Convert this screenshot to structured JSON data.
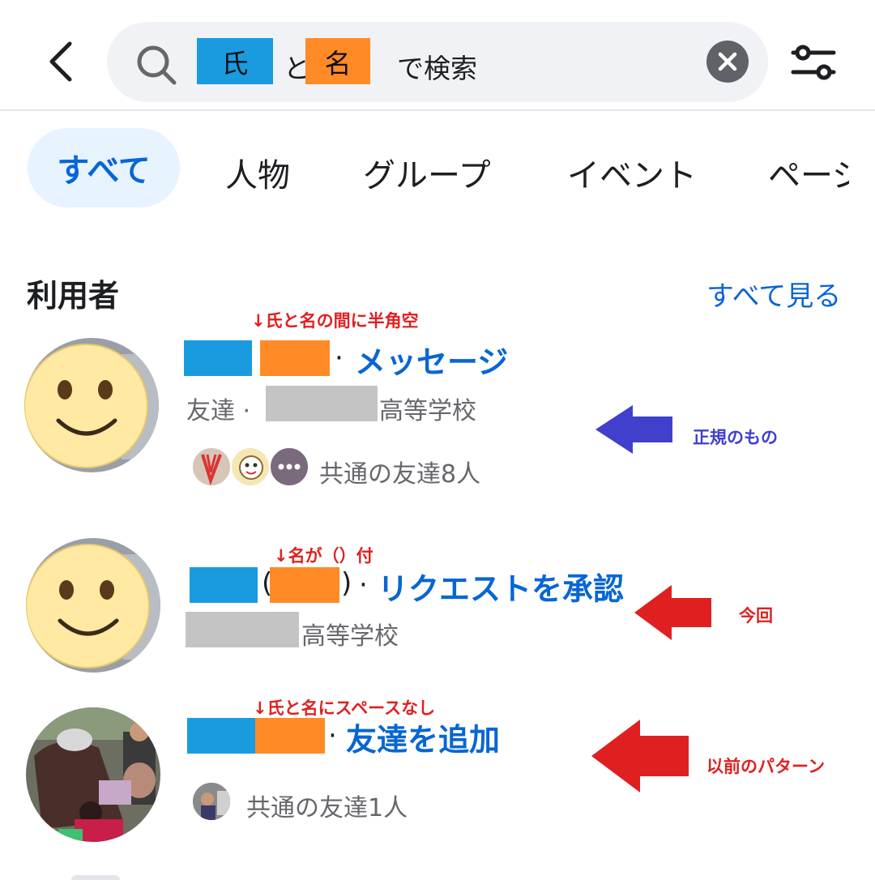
{
  "search": {
    "surname": "氏",
    "connector": "と",
    "given_name": "名",
    "suffix": "で検索"
  },
  "tabs": [
    "すべて",
    "人物",
    "グループ",
    "イベント",
    "ページ"
  ],
  "section": {
    "title": "利用者",
    "see_all": "すべて見る"
  },
  "results": [
    {
      "action": "メッセージ",
      "sub_prefix": "友達 · ",
      "school_suffix": "高等学校",
      "mutual": "共通の友達8人",
      "note_top": "↓氏と名の間に半角空",
      "arrow_label": "正規のもの"
    },
    {
      "action": "リクエストを承認",
      "school_suffix": "高等学校",
      "note_top": "↓名が（）付",
      "arrow_label": "今回"
    },
    {
      "action": "友達を追加",
      "mutual": "共通の友達1人",
      "note_top": "↓氏と名にスペースなし",
      "arrow_label": "以前のパターン"
    }
  ],
  "colors": {
    "accent": "#0866d4",
    "surname_block": "#1a9be0",
    "given_block": "#ff8a26",
    "redact": "#c4c4c4",
    "annotation_red": "#e02020",
    "annotation_blue": "#4040cc"
  }
}
